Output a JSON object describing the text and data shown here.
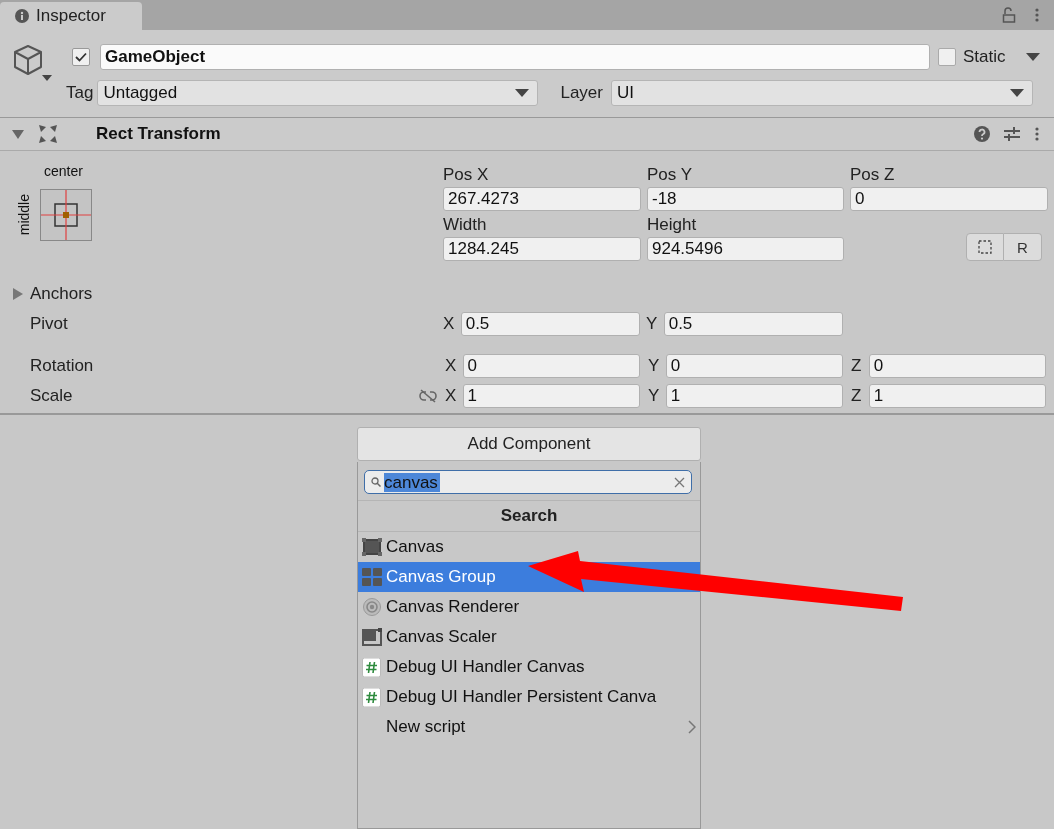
{
  "tab": {
    "title": "Inspector",
    "selected": true
  },
  "game_object": {
    "active": true,
    "name": "GameObject",
    "static": false,
    "static_label": "Static",
    "tag_label": "Tag",
    "tag": "Untagged",
    "layer_label": "Layer",
    "layer": "UI"
  },
  "component": {
    "title": "Rect Transform",
    "expanded": true,
    "anchor_preset": {
      "horizontal": "center",
      "vertical": "middle"
    },
    "position_fields": [
      {
        "label": "Pos X",
        "value": "267.4273"
      },
      {
        "label": "Pos Y",
        "value": "-18"
      },
      {
        "label": "Pos Z",
        "value": "0"
      }
    ],
    "size_fields": [
      {
        "label": "Width",
        "value": "1284.245"
      },
      {
        "label": "Height",
        "value": "924.5496"
      }
    ],
    "raw_button": "R",
    "anchors": {
      "label": "Anchors",
      "expanded": false
    },
    "vector_rows": [
      {
        "label": "Pivot",
        "kind": "pivot",
        "fields": [
          {
            "axis": "X",
            "value": "0.5"
          },
          {
            "axis": "Y",
            "value": "0.5"
          }
        ]
      },
      {
        "label": "Rotation",
        "kind": "vector",
        "fields": [
          {
            "axis": "X",
            "value": "0"
          },
          {
            "axis": "Y",
            "value": "0"
          },
          {
            "axis": "Z",
            "value": "0"
          }
        ]
      },
      {
        "label": "Scale",
        "kind": "scale",
        "fields": [
          {
            "axis": "X",
            "value": "1"
          },
          {
            "axis": "Y",
            "value": "1"
          },
          {
            "axis": "Z",
            "value": "1"
          }
        ]
      }
    ]
  },
  "add_component": {
    "button": "Add Component",
    "search": {
      "value": "canvas"
    },
    "header": "Search",
    "items": [
      {
        "label": "Canvas",
        "kind": "canvas",
        "selected": false
      },
      {
        "label": "Canvas Group",
        "kind": "canvas-group",
        "selected": true
      },
      {
        "label": "Canvas Renderer",
        "kind": "renderer",
        "selected": false
      },
      {
        "label": "Canvas Scaler",
        "kind": "scaler",
        "selected": false
      },
      {
        "label": "Debug UI Handler Canvas",
        "kind": "script",
        "selected": false
      },
      {
        "label": "Debug UI Handler Persistent Canva",
        "kind": "script",
        "selected": false
      },
      {
        "label": "New script",
        "kind": "submenu",
        "selected": false
      }
    ]
  }
}
